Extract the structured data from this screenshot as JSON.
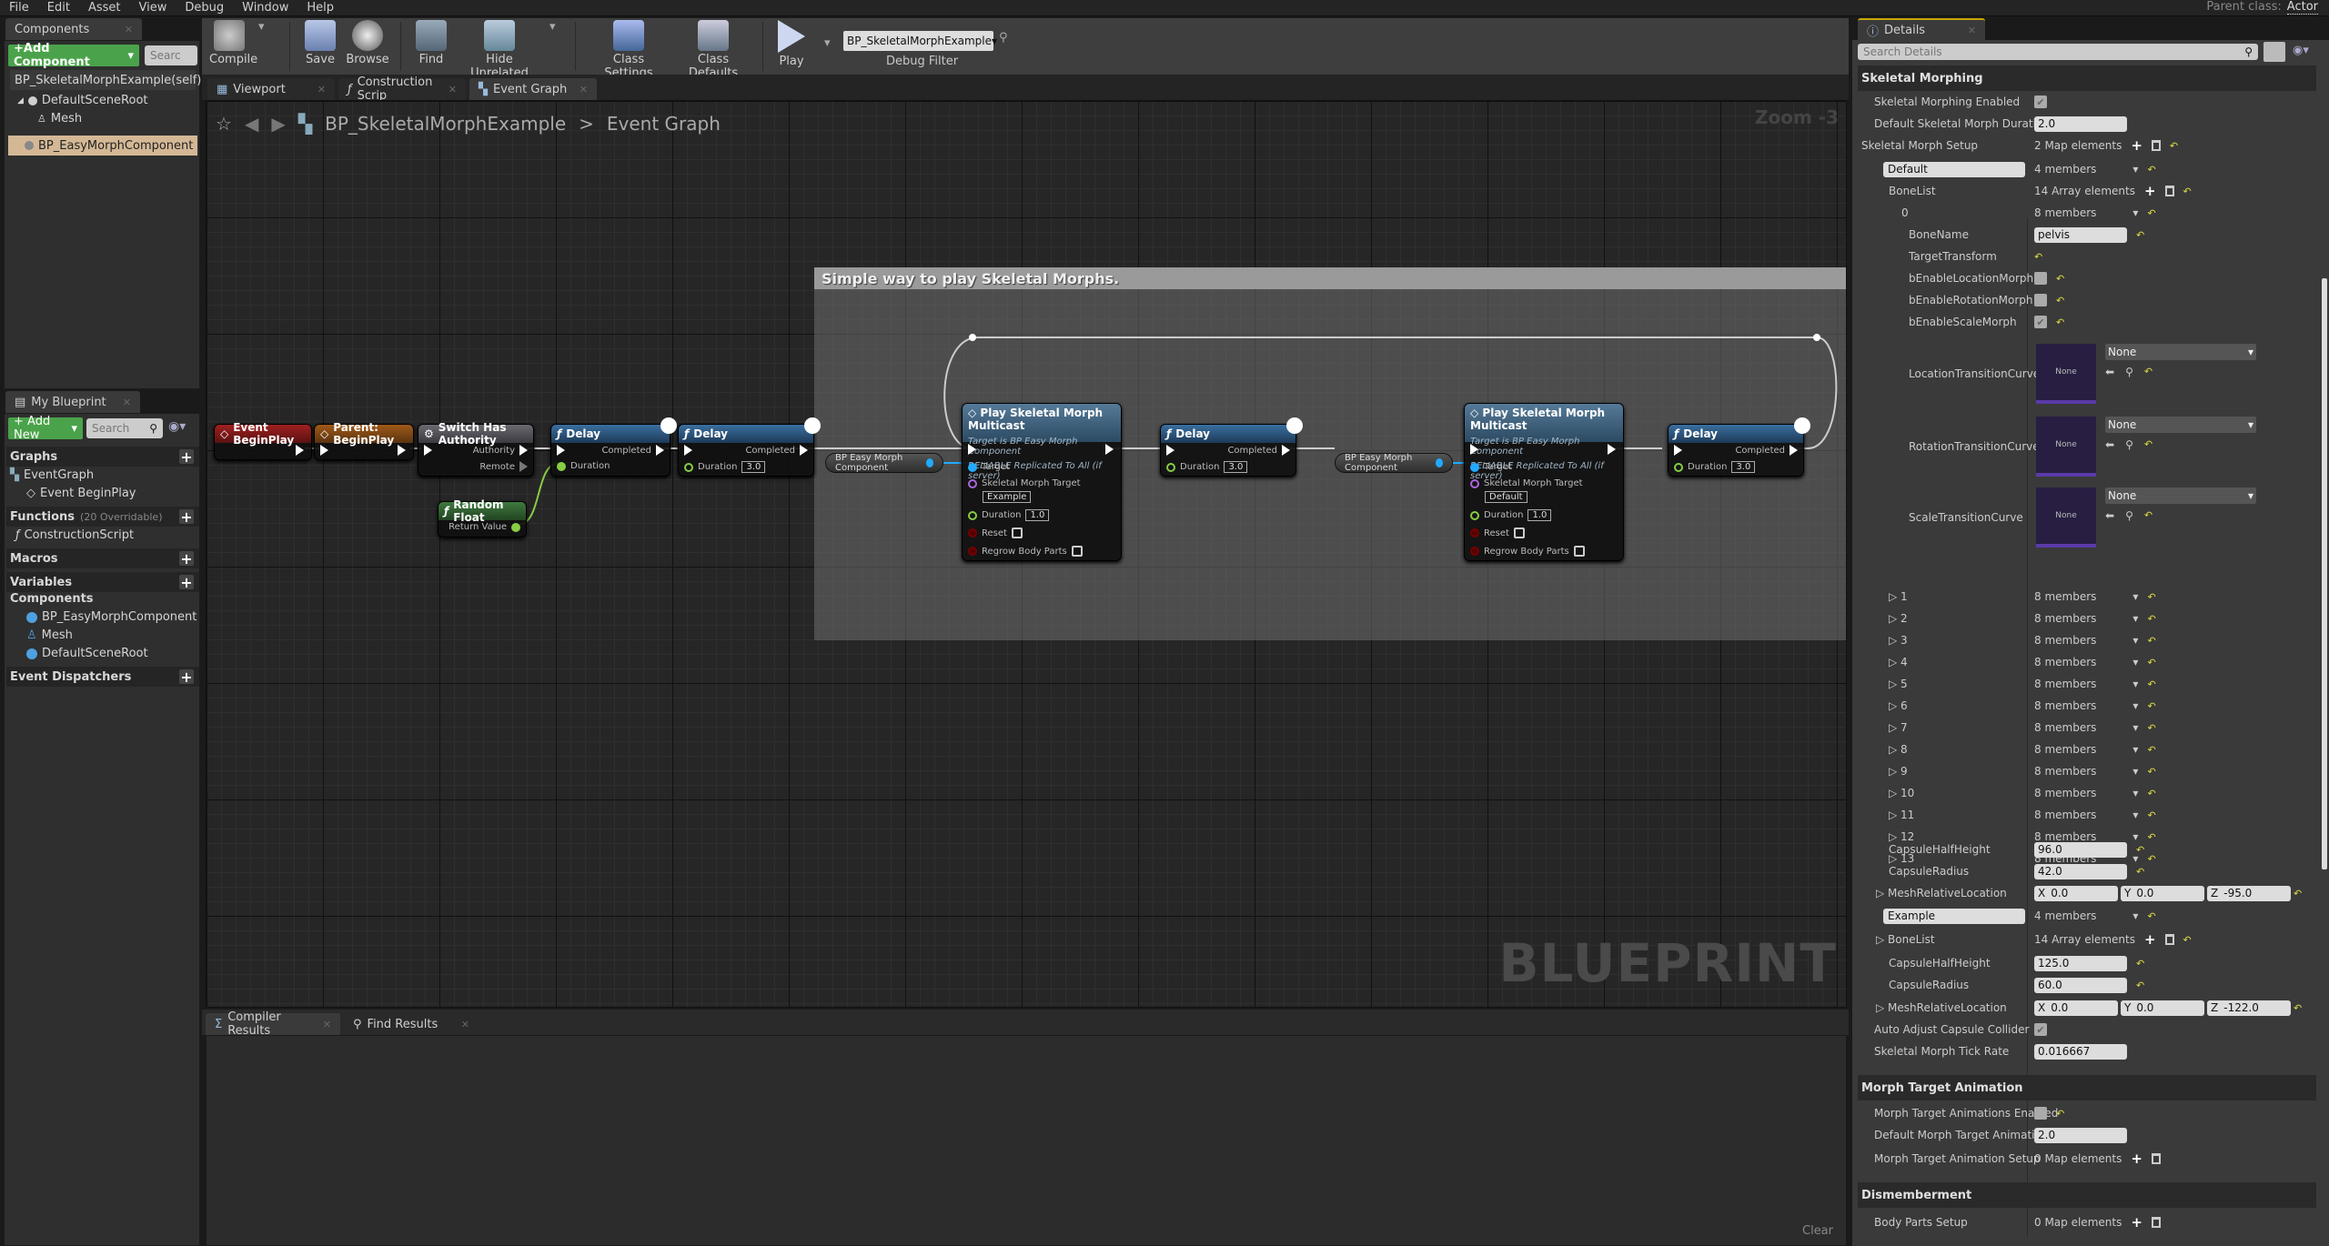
{
  "menu": [
    "File",
    "Edit",
    "Asset",
    "View",
    "Debug",
    "Window",
    "Help"
  ],
  "parent_class": {
    "label": "Parent class:",
    "value": "Actor"
  },
  "components_panel": {
    "tab": "Components",
    "add_button": "+Add Component",
    "search_placeholder": "Searc",
    "self_item": "BP_SkeletalMorphExample(self)",
    "tree": [
      {
        "label": "DefaultSceneRoot"
      },
      {
        "label": "Mesh"
      },
      {
        "label": "BP_EasyMorphComponent",
        "selected": true
      }
    ]
  },
  "toolbar": {
    "compile": "Compile",
    "save": "Save",
    "browse": "Browse",
    "find": "Find",
    "hide_unrelated": "Hide Unrelated",
    "class_settings": "Class Settings",
    "class_defaults": "Class Defaults",
    "play": "Play",
    "debug_selected": "BP_SkeletalMorphExample",
    "debug_filter": "Debug Filter"
  },
  "editor_tabs": [
    {
      "label": "Viewport"
    },
    {
      "label": "Construction Scrip"
    },
    {
      "label": "Event Graph",
      "active": true
    }
  ],
  "graph": {
    "breadcrumb_root": "BP_SkeletalMorphExample",
    "breadcrumb_sep": ">",
    "breadcrumb_leaf": "Event Graph",
    "zoom": "Zoom -3",
    "watermark": "BLUEPRINT",
    "comment": "Simple way to play Skeletal Morphs.",
    "nodes": {
      "begin_play": "Event BeginPlay",
      "parent_begin_play": "Parent: BeginPlay",
      "switch": {
        "title": "Switch Has Authority",
        "authority": "Authority",
        "remote": "Remote"
      },
      "random_float": {
        "title": "Random Float",
        "out": "Return Value"
      },
      "delay1": {
        "title": "Delay",
        "completed": "Completed",
        "duration": "Duration"
      },
      "delay2": {
        "title": "Delay",
        "completed": "Completed",
        "duration": "Duration",
        "value": "3.0"
      },
      "var1": "BP Easy Morph Component",
      "mc1": {
        "title": "Play Skeletal Morph Multicast",
        "sub1": "Target is BP Easy Morph Component",
        "sub2": "RELIABLE Replicated To All (if server)",
        "target": "Target",
        "smt": "Skeletal Morph Target",
        "smt_value": "Example",
        "duration": "Duration",
        "duration_value": "1.0",
        "reset": "Reset",
        "regrow": "Regrow Body Parts"
      },
      "delay3": {
        "title": "Delay",
        "completed": "Completed",
        "duration": "Duration",
        "value": "3.0"
      },
      "var2": "BP Easy Morph Component",
      "mc2": {
        "title": "Play Skeletal Morph Multicast",
        "sub1": "Target is BP Easy Morph Component",
        "sub2": "RELIABLE Replicated To All (if server)",
        "target": "Target",
        "smt": "Skeletal Morph Target",
        "smt_value": "Default",
        "duration": "Duration",
        "duration_value": "1.0",
        "reset": "Reset",
        "regrow": "Regrow Body Parts"
      },
      "delay4": {
        "title": "Delay",
        "completed": "Completed",
        "duration": "Duration",
        "value": "3.0"
      }
    }
  },
  "my_blueprint": {
    "tab": "My Blueprint",
    "add_new": "+ Add New",
    "search_placeholder": "Search",
    "graphs": "Graphs",
    "event_graph": "EventGraph",
    "event_begin_play": "Event BeginPlay",
    "functions": "Functions",
    "functions_sub": "(20 Overridable)",
    "construction_script": "ConstructionScript",
    "macros": "Macros",
    "variables": "Variables",
    "components": "Components",
    "component_items": [
      "BP_EasyMorphComponent",
      "Mesh",
      "DefaultSceneRoot"
    ],
    "event_dispatchers": "Event Dispatchers"
  },
  "bottom": {
    "tabs": [
      "Compiler Results",
      "Find Results"
    ],
    "clear": "Clear"
  },
  "details": {
    "tab": "Details",
    "search_placeholder": "Search Details",
    "skeletal_morphing": "Skeletal Morphing",
    "sm_enabled": {
      "label": "Skeletal Morphing Enabled",
      "checked": true
    },
    "sm_duration": {
      "label": "Default Skeletal Morph Duration",
      "value": "2.0"
    },
    "sm_setup": {
      "label": "Skeletal Morph Setup",
      "value": "2 Map elements"
    },
    "default_key": "Default",
    "members4": "4 members",
    "bonelist": {
      "label": "BoneList",
      "value": "14 Array elements"
    },
    "item0": {
      "label": "0",
      "value": "8 members"
    },
    "bonename": {
      "label": "BoneName",
      "value": "pelvis"
    },
    "target_transform": "TargetTransform",
    "loc_morph": {
      "label": "bEnableLocationMorph",
      "checked": false
    },
    "rot_morph": {
      "label": "bEnableRotationMorph",
      "checked": false
    },
    "scale_morph": {
      "label": "bEnableScaleMorph",
      "checked": true
    },
    "curves": [
      {
        "label": "LocationTransitionCurve",
        "value": "None"
      },
      {
        "label": "RotationTransitionCurve",
        "value": "None"
      },
      {
        "label": "ScaleTransitionCurve",
        "value": "None"
      }
    ],
    "bone_items": [
      "1",
      "2",
      "3",
      "4",
      "5",
      "6",
      "7",
      "8",
      "9",
      "10",
      "11",
      "12",
      "13"
    ],
    "members8": "8 members",
    "default_capsule_half": {
      "label": "CapsuleHalfHeight",
      "value": "96.0"
    },
    "default_capsule_radius": {
      "label": "CapsuleRadius",
      "value": "42.0"
    },
    "default_mesh_loc": {
      "label": "MeshRelativeLocation",
      "x": "0.0",
      "y": "0.0",
      "z": "-95.0"
    },
    "example_key": "Example",
    "example_bonelist": {
      "label": "BoneList",
      "value": "14 Array elements"
    },
    "example_capsule_half": {
      "label": "CapsuleHalfHeight",
      "value": "125.0"
    },
    "example_capsule_radius": {
      "label": "CapsuleRadius",
      "value": "60.0"
    },
    "example_mesh_loc": {
      "label": "MeshRelativeLocation",
      "x": "0.0",
      "y": "0.0",
      "z": "-122.0"
    },
    "auto_adjust": {
      "label": "Auto Adjust Capsule Collider",
      "checked": true
    },
    "tick_rate": {
      "label": "Skeletal Morph Tick Rate",
      "value": "0.016667"
    },
    "morph_target_animation": "Morph Target Animation",
    "mta_enabled": {
      "label": "Morph Target Animations Enabled",
      "checked": false
    },
    "mta_duration": {
      "label": "Default Morph Target Animation D",
      "value": "2.0"
    },
    "mta_setup": {
      "label": "Morph Target Animation Setup",
      "value": "0 Map elements"
    },
    "dismemberment": "Dismemberment",
    "body_parts": {
      "label": "Body Parts Setup",
      "value": "0 Map elements"
    }
  }
}
